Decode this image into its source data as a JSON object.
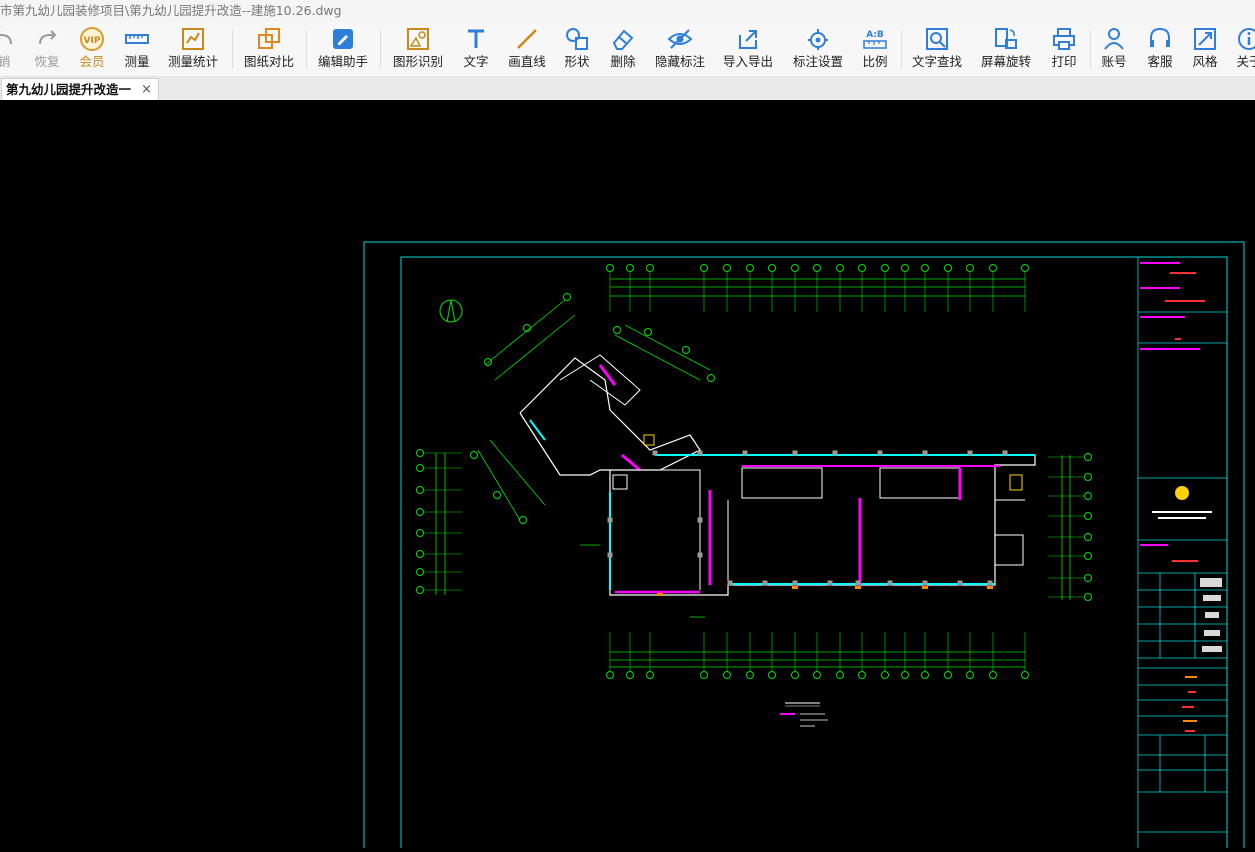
{
  "window": {
    "title": "市第九幼儿园装修项目\\第九幼儿园提升改造--建施10.26.dwg"
  },
  "toolbar": {
    "items": [
      {
        "label": "销",
        "icon": "undo-icon"
      },
      {
        "label": "恢复",
        "icon": "redo-icon"
      },
      {
        "label": "会员",
        "icon": "vip-icon"
      },
      {
        "label": "测量",
        "icon": "ruler-icon"
      },
      {
        "label": "测量统计",
        "icon": "measure-stats-icon"
      },
      {
        "label": "图纸对比",
        "icon": "compare-icon"
      },
      {
        "label": "编辑助手",
        "icon": "edit-assistant-icon"
      },
      {
        "label": "图形识别",
        "icon": "shape-recognize-icon"
      },
      {
        "label": "文字",
        "icon": "text-icon"
      },
      {
        "label": "画直线",
        "icon": "line-icon"
      },
      {
        "label": "形状",
        "icon": "shape-icon"
      },
      {
        "label": "删除",
        "icon": "eraser-icon"
      },
      {
        "label": "隐藏标注",
        "icon": "hide-eye-icon"
      },
      {
        "label": "导入导出",
        "icon": "import-export-icon"
      },
      {
        "label": "标注设置",
        "icon": "annotation-settings-icon"
      },
      {
        "label": "比例",
        "icon": "scale-icon"
      },
      {
        "label": "文字查找",
        "icon": "text-search-icon"
      },
      {
        "label": "屏幕旋转",
        "icon": "rotate-screen-icon"
      },
      {
        "label": "打印",
        "icon": "print-icon"
      },
      {
        "label": "账号",
        "icon": "user-icon"
      },
      {
        "label": "客服",
        "icon": "headset-icon"
      },
      {
        "label": "风格",
        "icon": "style-icon"
      },
      {
        "label": "关于",
        "icon": "info-icon"
      }
    ],
    "vip_badge": "VIP",
    "scale_badge": "A:B"
  },
  "tabs": [
    {
      "label": "第九幼儿园提升改造一",
      "close": "×"
    }
  ],
  "drawing": {
    "colors": {
      "frame": "#00d8d8",
      "grid": "#00e000",
      "wall": "#ffffff",
      "magenta": "#ff00ff",
      "cyan": "#00ffff",
      "red": "#ff3030",
      "yellow": "#ffd200",
      "orange": "#ff8a00",
      "column": "#9a9a9a"
    }
  }
}
